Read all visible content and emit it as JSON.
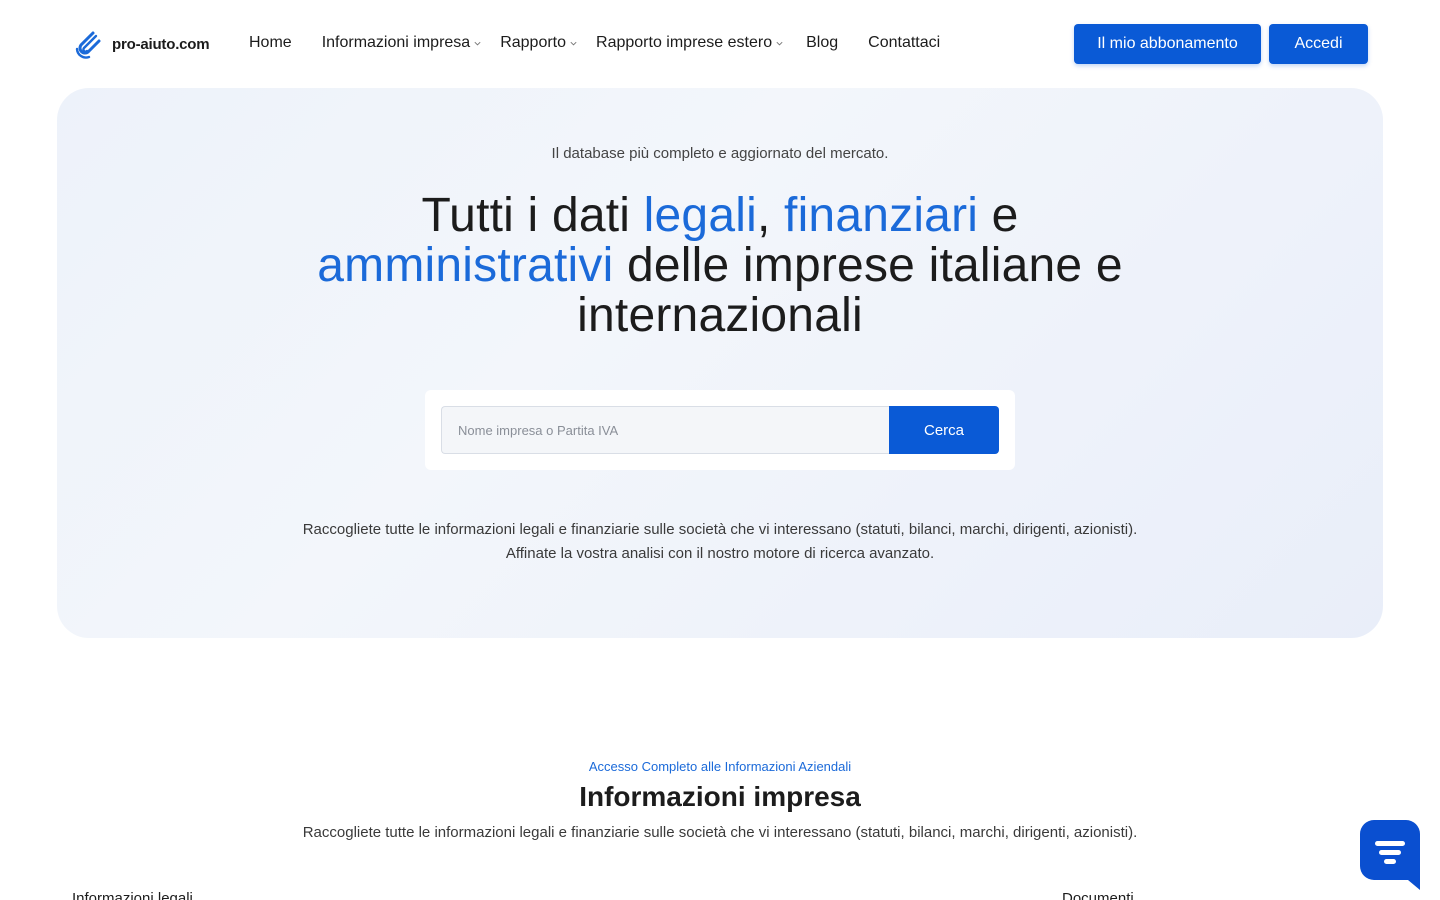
{
  "brand": {
    "name": "pro-aiuto.com"
  },
  "nav": {
    "home": "Home",
    "info": "Informazioni impresa",
    "report": "Rapporto",
    "foreign": "Rapporto imprese estero",
    "blog": "Blog",
    "contact": "Contattaci"
  },
  "actions": {
    "subscription": "Il mio abbonamento",
    "login": "Accedi"
  },
  "hero": {
    "kicker": "Il database più completo e aggiornato del mercato.",
    "title": {
      "p1": "Tutti i dati ",
      "h1": "legali",
      "p2": ", ",
      "h2": "finanziari",
      "p3": " e ",
      "h3": "amministrativi",
      "p4": " delle imprese italiane e internazionali"
    },
    "search": {
      "placeholder": "Nome impresa o Partita IVA",
      "button": "Cerca"
    },
    "desc_line1": "Raccogliete tutte le informazioni legali e finanziarie sulle società che vi interessano (statuti, bilanci, marchi, dirigenti, azionisti).",
    "desc_line2": "Affinate la vostra analisi con il nostro motore di ricerca avanzato."
  },
  "section": {
    "kicker": "Accesso Completo alle Informazioni Aziendali",
    "title": "Informazioni impresa",
    "desc": "Raccogliete tutte le informazioni legali e finanziarie sulle società che vi interessano (statuti, bilanci, marchi, dirigenti, azionisti).",
    "col_left": "Informazioni legali",
    "col_right": "Documenti"
  },
  "colors": {
    "accent": "#0a5ad6",
    "highlight": "#1b6ad9",
    "hero_bg": "#eef2fa"
  }
}
